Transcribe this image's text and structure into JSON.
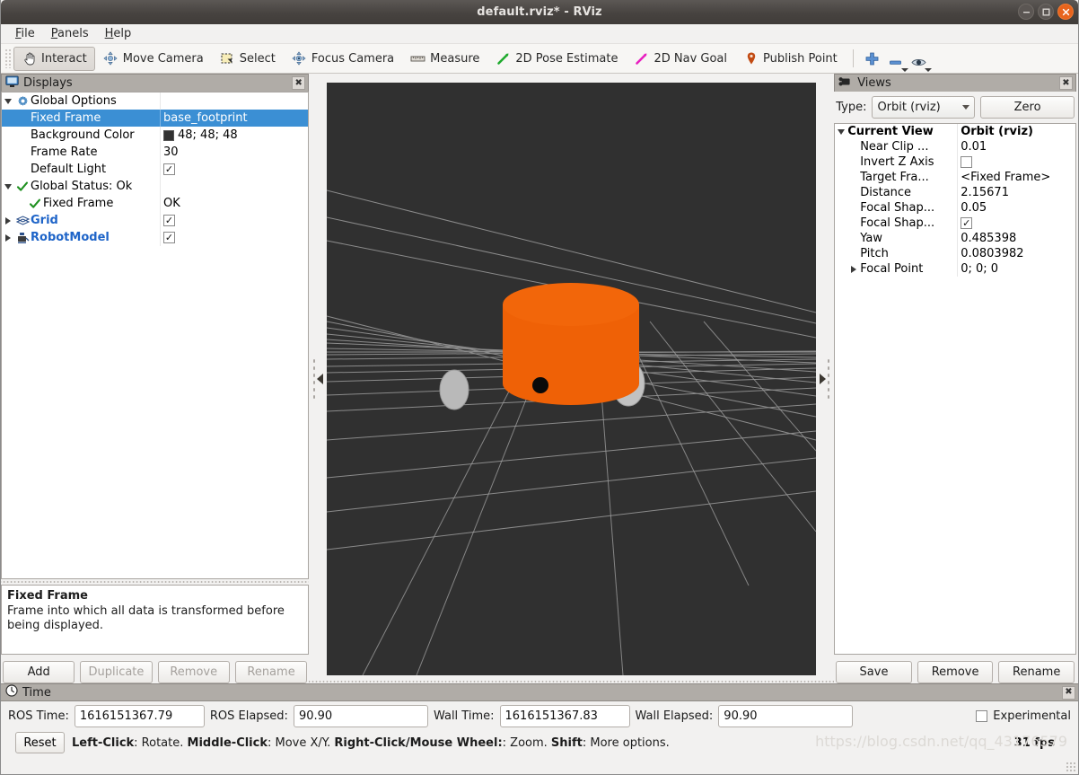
{
  "window": {
    "title": "default.rviz* - RViz",
    "minimize_label": "–",
    "maximize_label": "□",
    "close_label": "×"
  },
  "menubar": {
    "items": [
      {
        "label": "File",
        "mnemonic": "F"
      },
      {
        "label": "Panels",
        "mnemonic": "P"
      },
      {
        "label": "Help",
        "mnemonic": "H"
      }
    ]
  },
  "toolbar": {
    "buttons": [
      {
        "label": "Interact",
        "icon": "hand-cursor-icon",
        "active": true
      },
      {
        "label": "Move Camera",
        "icon": "move-camera-icon",
        "active": false
      },
      {
        "label": "Select",
        "icon": "select-rect-icon",
        "active": false
      },
      {
        "label": "Focus Camera",
        "icon": "focus-camera-icon",
        "active": false
      },
      {
        "label": "Measure",
        "icon": "ruler-icon",
        "active": false
      },
      {
        "label": "2D Pose Estimate",
        "icon": "pose-estimate-arrow-icon",
        "active": false
      },
      {
        "label": "2D Nav Goal",
        "icon": "nav-goal-arrow-icon",
        "active": false
      },
      {
        "label": "Publish Point",
        "icon": "map-pin-icon",
        "active": false
      }
    ],
    "icon_buttons": [
      {
        "name": "add-tool-icon",
        "label": "+"
      },
      {
        "name": "remove-tool-icon",
        "label": "–"
      },
      {
        "name": "visibility-eye-icon",
        "label": "eye"
      }
    ]
  },
  "displays": {
    "title": "Displays",
    "title_icon": "monitor-icon",
    "close_label": "✖",
    "rows": [
      {
        "indent": 0,
        "twist": "down",
        "icon": "gear-icon",
        "label": "Global Options",
        "bold": false,
        "blue": false,
        "value_type": "none",
        "value": ""
      },
      {
        "indent": 2,
        "twist": "none",
        "icon": "none",
        "label": "Fixed Frame",
        "bold": false,
        "blue": false,
        "value_type": "text",
        "value": "base_footprint",
        "selected": true
      },
      {
        "indent": 2,
        "twist": "none",
        "icon": "none",
        "label": "Background Color",
        "bold": false,
        "blue": false,
        "value_type": "swatch",
        "value": "48; 48; 48"
      },
      {
        "indent": 2,
        "twist": "none",
        "icon": "none",
        "label": "Frame Rate",
        "bold": false,
        "blue": false,
        "value_type": "text",
        "value": "30"
      },
      {
        "indent": 2,
        "twist": "none",
        "icon": "none",
        "label": "Default Light",
        "bold": false,
        "blue": false,
        "value_type": "checkbox",
        "value": "✓"
      },
      {
        "indent": 0,
        "twist": "down",
        "icon": "green-check",
        "label": "Global Status: Ok",
        "bold": false,
        "blue": false,
        "value_type": "none",
        "value": ""
      },
      {
        "indent": 1,
        "twist": "none",
        "icon": "green-check-sm",
        "label": "Fixed Frame",
        "bold": false,
        "blue": false,
        "value_type": "text",
        "value": "OK"
      },
      {
        "indent": 0,
        "twist": "right",
        "icon": "grid-icon",
        "label": "Grid",
        "bold": true,
        "blue": true,
        "value_type": "checkbox",
        "value": "✓"
      },
      {
        "indent": 0,
        "twist": "right",
        "icon": "robot-icon",
        "label": "RobotModel",
        "bold": true,
        "blue": true,
        "value_type": "checkbox",
        "value": "✓"
      }
    ],
    "help": {
      "title": "Fixed Frame",
      "text": "Frame into which all data is transformed before being displayed."
    },
    "buttons": [
      {
        "label": "Add",
        "enabled": true
      },
      {
        "label": "Duplicate",
        "enabled": false
      },
      {
        "label": "Remove",
        "enabled": false
      },
      {
        "label": "Rename",
        "enabled": false
      }
    ]
  },
  "views": {
    "title": "Views",
    "title_icon": "camera-icon",
    "close_label": "✖",
    "type_label": "Type:",
    "type_value": "Orbit (rviz)",
    "zero_label": "Zero",
    "rows": [
      {
        "indent": 0,
        "twist": "down",
        "label": "Current View",
        "bold": true,
        "value": "Orbit (rviz)",
        "value_bold": true,
        "value_type": "text"
      },
      {
        "indent": 1,
        "twist": "none",
        "label": "Near Clip ...",
        "bold": false,
        "value": "0.01",
        "value_bold": false,
        "value_type": "text"
      },
      {
        "indent": 1,
        "twist": "none",
        "label": "Invert Z Axis",
        "bold": false,
        "value": "",
        "value_bold": false,
        "value_type": "checkbox-empty"
      },
      {
        "indent": 1,
        "twist": "none",
        "label": "Target Fra...",
        "bold": false,
        "value": "<Fixed Frame>",
        "value_bold": false,
        "value_type": "text"
      },
      {
        "indent": 1,
        "twist": "none",
        "label": "Distance",
        "bold": false,
        "value": "2.15671",
        "value_bold": false,
        "value_type": "text"
      },
      {
        "indent": 1,
        "twist": "none",
        "label": "Focal Shap...",
        "bold": false,
        "value": "0.05",
        "value_bold": false,
        "value_type": "text"
      },
      {
        "indent": 1,
        "twist": "none",
        "label": "Focal Shap...",
        "bold": false,
        "value": "✓",
        "value_bold": false,
        "value_type": "checkbox"
      },
      {
        "indent": 1,
        "twist": "none",
        "label": "Yaw",
        "bold": false,
        "value": "0.485398",
        "value_bold": false,
        "value_type": "text"
      },
      {
        "indent": 1,
        "twist": "none",
        "label": "Pitch",
        "bold": false,
        "value": "0.0803982",
        "value_bold": false,
        "value_type": "text"
      },
      {
        "indent": 1,
        "twist": "right",
        "label": "Focal Point",
        "bold": false,
        "value": "0; 0; 0",
        "value_bold": false,
        "value_type": "text"
      }
    ],
    "buttons": [
      {
        "label": "Save"
      },
      {
        "label": "Remove"
      },
      {
        "label": "Rename"
      }
    ]
  },
  "viewport": {
    "background_color": "#303030",
    "robot_body_color": "#ef6106",
    "wheel_color": "#b9b9b9",
    "caster_color": "#0a0a0a",
    "grid_color": "#9b9b9b",
    "collapse_left_icon": "collapse-left-arrow-icon",
    "collapse_right_icon": "collapse-right-arrow-icon"
  },
  "time": {
    "title": "Time",
    "title_icon": "clock-icon",
    "close_label": "✖",
    "fields": [
      {
        "label": "ROS Time:",
        "value": "1616151367.79"
      },
      {
        "label": "ROS Elapsed:",
        "value": "90.90"
      },
      {
        "label": "Wall Time:",
        "value": "1616151367.83"
      },
      {
        "label": "Wall Elapsed:",
        "value": "90.90"
      }
    ],
    "experimental_label": "Experimental",
    "experimental_checked": false,
    "reset_label": "Reset",
    "hint_segments": [
      {
        "text": "Left-Click",
        "bold": true
      },
      {
        "text": ": Rotate. ",
        "bold": false
      },
      {
        "text": "Middle-Click",
        "bold": true
      },
      {
        "text": ": Move X/Y. ",
        "bold": false
      },
      {
        "text": "Right-Click/Mouse Wheel:",
        "bold": true
      },
      {
        "text": ": Zoom. ",
        "bold": false
      },
      {
        "text": "Shift",
        "bold": true
      },
      {
        "text": ": More options.",
        "bold": false
      }
    ],
    "fps": "31 fps",
    "watermark": "https://blog.csdn.net/qq_43176579"
  }
}
